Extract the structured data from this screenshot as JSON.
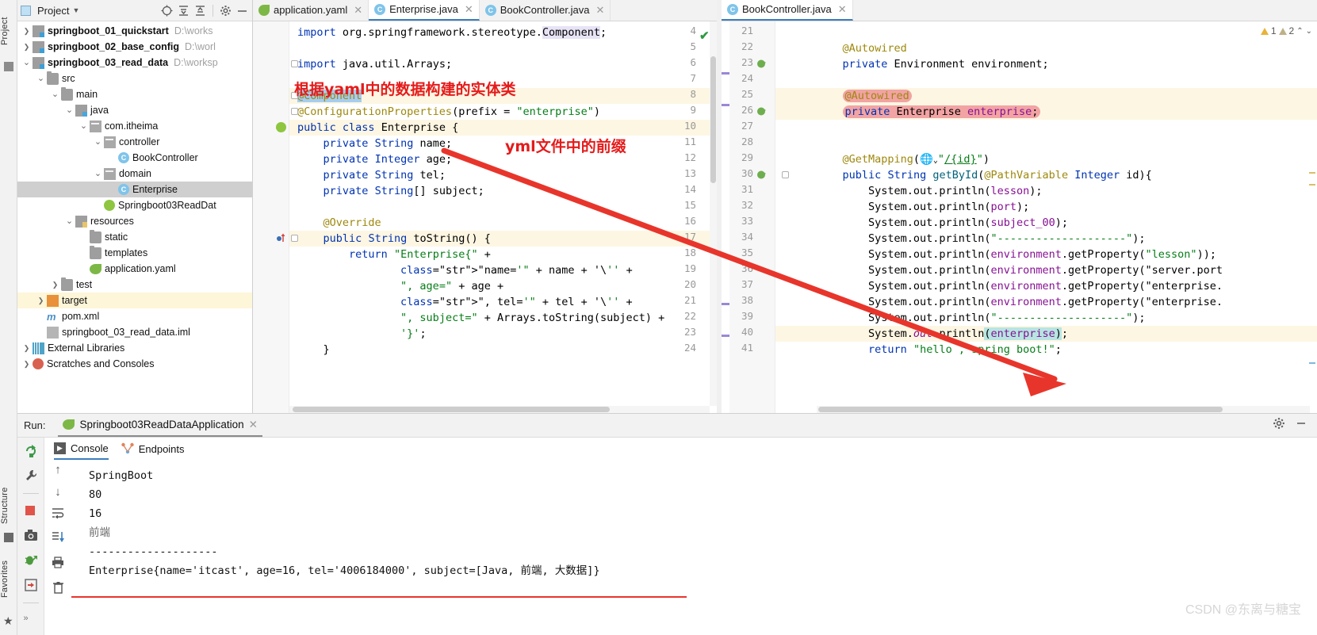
{
  "window": {
    "left_rail": {
      "project": "Project",
      "structure": "Structure",
      "favorites": "Favorites"
    }
  },
  "project_panel": {
    "title": "Project",
    "icons": [
      "locate-icon",
      "expand-all-icon",
      "collapse-all-icon",
      "gear-icon",
      "minimize-icon"
    ],
    "tree": [
      {
        "indent": 0,
        "arrow": "right",
        "icon": "module-folder-icon",
        "label": "springboot_01_quickstart",
        "bold": true,
        "path": "D:\\works",
        "state": ""
      },
      {
        "indent": 0,
        "arrow": "right",
        "icon": "module-folder-icon",
        "label": "springboot_02_base_config",
        "bold": true,
        "path": "D:\\worl",
        "state": ""
      },
      {
        "indent": 0,
        "arrow": "down",
        "icon": "module-folder-icon",
        "label": "springboot_03_read_data",
        "bold": true,
        "path": "D:\\worksp",
        "state": ""
      },
      {
        "indent": 1,
        "arrow": "down",
        "icon": "folder-icon",
        "label": "src",
        "bold": false,
        "path": "",
        "state": ""
      },
      {
        "indent": 2,
        "arrow": "down",
        "icon": "folder-icon",
        "label": "main",
        "bold": false,
        "path": "",
        "state": ""
      },
      {
        "indent": 3,
        "arrow": "down",
        "icon": "source-folder-icon",
        "label": "java",
        "bold": false,
        "path": "",
        "state": ""
      },
      {
        "indent": 4,
        "arrow": "down",
        "icon": "package-icon",
        "label": "com.itheima",
        "bold": false,
        "path": "",
        "state": ""
      },
      {
        "indent": 5,
        "arrow": "down",
        "icon": "package-icon",
        "label": "controller",
        "bold": false,
        "path": "",
        "state": ""
      },
      {
        "indent": 6,
        "arrow": "none",
        "icon": "java-class-icon",
        "label": "BookController",
        "bold": false,
        "path": "",
        "state": ""
      },
      {
        "indent": 5,
        "arrow": "down",
        "icon": "package-icon",
        "label": "domain",
        "bold": false,
        "path": "",
        "state": ""
      },
      {
        "indent": 6,
        "arrow": "none",
        "icon": "java-class-icon",
        "label": "Enterprise",
        "bold": false,
        "path": "",
        "state": "selected"
      },
      {
        "indent": 5,
        "arrow": "none",
        "icon": "spring-class-icon",
        "label": "Springboot03ReadDat",
        "bold": false,
        "path": "",
        "state": ""
      },
      {
        "indent": 3,
        "arrow": "down",
        "icon": "resources-folder-icon",
        "label": "resources",
        "bold": false,
        "path": "",
        "state": ""
      },
      {
        "indent": 4,
        "arrow": "none",
        "icon": "folder-icon",
        "label": "static",
        "bold": false,
        "path": "",
        "state": ""
      },
      {
        "indent": 4,
        "arrow": "none",
        "icon": "folder-icon",
        "label": "templates",
        "bold": false,
        "path": "",
        "state": ""
      },
      {
        "indent": 4,
        "arrow": "none",
        "icon": "yaml-spring-icon",
        "label": "application.yaml",
        "bold": false,
        "path": "",
        "state": ""
      },
      {
        "indent": 2,
        "arrow": "right",
        "icon": "folder-icon",
        "label": "test",
        "bold": false,
        "path": "",
        "state": ""
      },
      {
        "indent": 1,
        "arrow": "right",
        "icon": "target-folder-icon",
        "label": "target",
        "bold": false,
        "path": "",
        "state": "highlight"
      },
      {
        "indent": 1,
        "arrow": "none",
        "icon": "maven-icon",
        "label": "pom.xml",
        "bold": false,
        "path": "",
        "state": ""
      },
      {
        "indent": 1,
        "arrow": "none",
        "icon": "iml-icon",
        "label": "springboot_03_read_data.iml",
        "bold": false,
        "path": "",
        "state": ""
      },
      {
        "indent": 0,
        "arrow": "right",
        "icon": "libraries-icon",
        "label": "External Libraries",
        "bold": false,
        "path": "",
        "state": ""
      },
      {
        "indent": 0,
        "arrow": "right",
        "icon": "scratches-icon",
        "label": "Scratches and Consoles",
        "bold": false,
        "path": "",
        "state": ""
      }
    ]
  },
  "editor_left": {
    "tabs": [
      {
        "label": "application.yaml",
        "icon": "yaml-spring-icon",
        "active": false,
        "closable": true
      },
      {
        "label": "Enterprise.java",
        "icon": "java-class-icon",
        "active": true,
        "closable": true
      },
      {
        "label": "BookController.java",
        "icon": "java-class-icon",
        "active": false,
        "closable": true
      }
    ],
    "first_line_number": 4,
    "lines": [
      {
        "n": 4,
        "text": "import org.springframework.stereotype.Component;"
      },
      {
        "n": 5,
        "text": ""
      },
      {
        "n": 6,
        "text": "import java.util.Arrays;"
      },
      {
        "n": 7,
        "text": ""
      },
      {
        "n": 8,
        "text": "@Component"
      },
      {
        "n": 9,
        "text": "@ConfigurationProperties(prefix = \"enterprise\")"
      },
      {
        "n": 10,
        "text": "public class Enterprise {"
      },
      {
        "n": 11,
        "text": "    private String name;"
      },
      {
        "n": 12,
        "text": "    private Integer age;"
      },
      {
        "n": 13,
        "text": "    private String tel;"
      },
      {
        "n": 14,
        "text": "    private String[] subject;"
      },
      {
        "n": 15,
        "text": ""
      },
      {
        "n": 16,
        "text": "    @Override"
      },
      {
        "n": 17,
        "text": "    public String toString() {"
      },
      {
        "n": 18,
        "text": "        return \"Enterprise{\" +"
      },
      {
        "n": 19,
        "text": "                \"name='\" + name + '\\'' +"
      },
      {
        "n": 20,
        "text": "                \", age=\" + age +"
      },
      {
        "n": 21,
        "text": "                \", tel='\" + tel + '\\'' +"
      },
      {
        "n": 22,
        "text": "                \", subject=\" + Arrays.toString(subject) +"
      },
      {
        "n": 23,
        "text": "                '}';"
      },
      {
        "n": 24,
        "text": "    }"
      }
    ]
  },
  "editor_right": {
    "tabs": [
      {
        "label": "BookController.java",
        "icon": "java-class-icon",
        "active": true,
        "closable": true
      }
    ],
    "inspection": {
      "warnings": "1",
      "weak_warnings": "2",
      "check_icon": "checkmark-icon"
    },
    "lines": [
      {
        "n": 21,
        "text": ""
      },
      {
        "n": 22,
        "text": "    @Autowired"
      },
      {
        "n": 23,
        "text": "    private Environment environment;"
      },
      {
        "n": 24,
        "text": ""
      },
      {
        "n": 25,
        "text": "    @Autowired"
      },
      {
        "n": 26,
        "text": "    private Enterprise enterprise;"
      },
      {
        "n": 27,
        "text": ""
      },
      {
        "n": 28,
        "text": ""
      },
      {
        "n": 29,
        "text": "    @GetMapping(\"/{id}\")"
      },
      {
        "n": 30,
        "text": "    public String getById(@PathVariable Integer id){"
      },
      {
        "n": 31,
        "text": "        System.out.println(lesson);"
      },
      {
        "n": 32,
        "text": "        System.out.println(port);"
      },
      {
        "n": 33,
        "text": "        System.out.println(subject_00);"
      },
      {
        "n": 34,
        "text": "        System.out.println(\"--------------------\");"
      },
      {
        "n": 35,
        "text": "        System.out.println(environment.getProperty(\"lesson\"));"
      },
      {
        "n": 36,
        "text": "        System.out.println(environment.getProperty(\"server.port"
      },
      {
        "n": 37,
        "text": "        System.out.println(environment.getProperty(\"enterprise."
      },
      {
        "n": 38,
        "text": "        System.out.println(environment.getProperty(\"enterprise."
      },
      {
        "n": 39,
        "text": "        System.out.println(\"--------------------\");"
      },
      {
        "n": 40,
        "text": "        System.out.println(enterprise);"
      },
      {
        "n": 41,
        "text": "        return \"hello , spring boot!\";"
      }
    ]
  },
  "run_panel": {
    "label": "Run:",
    "configuration": "Springboot03ReadDataApplication",
    "config_icon": "spring-run-icon",
    "close_icon": "close-icon",
    "settings_icon": "gear-icon",
    "minimize_icon": "minimize-icon",
    "subtabs": [
      {
        "label": "Console",
        "icon": "console-icon",
        "active": true
      },
      {
        "label": "Endpoints",
        "icon": "endpoints-icon",
        "active": false
      }
    ],
    "toolbar_icons": [
      "rerun-icon",
      "wrench-icon",
      "stop-icon",
      "camera-icon",
      "debug-icon",
      "export-icon",
      "trash-icon"
    ],
    "console_side_icons": [
      "up-arrow-icon",
      "down-arrow-icon",
      "soft-wrap-icon",
      "scroll-to-end-icon",
      "print-icon",
      "trash-icon"
    ],
    "output": [
      {
        "text": "SpringBoot",
        "style": "mono"
      },
      {
        "text": "80",
        "style": "mono"
      },
      {
        "text": "16",
        "style": "mono"
      },
      {
        "text": "前端",
        "style": "cjk"
      },
      {
        "text": "--------------------",
        "style": "mono"
      },
      {
        "text": "Enterprise{name='itcast', age=16, tel='4006184000', subject=[Java, 前端, 大数据]}",
        "style": "mono"
      }
    ]
  },
  "annotations": {
    "note_entity": "根据yaml中的数据构建的实体类",
    "note_prefix": "yml文件中的前缀",
    "arrow_color": "#e8352b",
    "underline_color": "#e8352b"
  },
  "watermark": "CSDN @东离与糖宝"
}
